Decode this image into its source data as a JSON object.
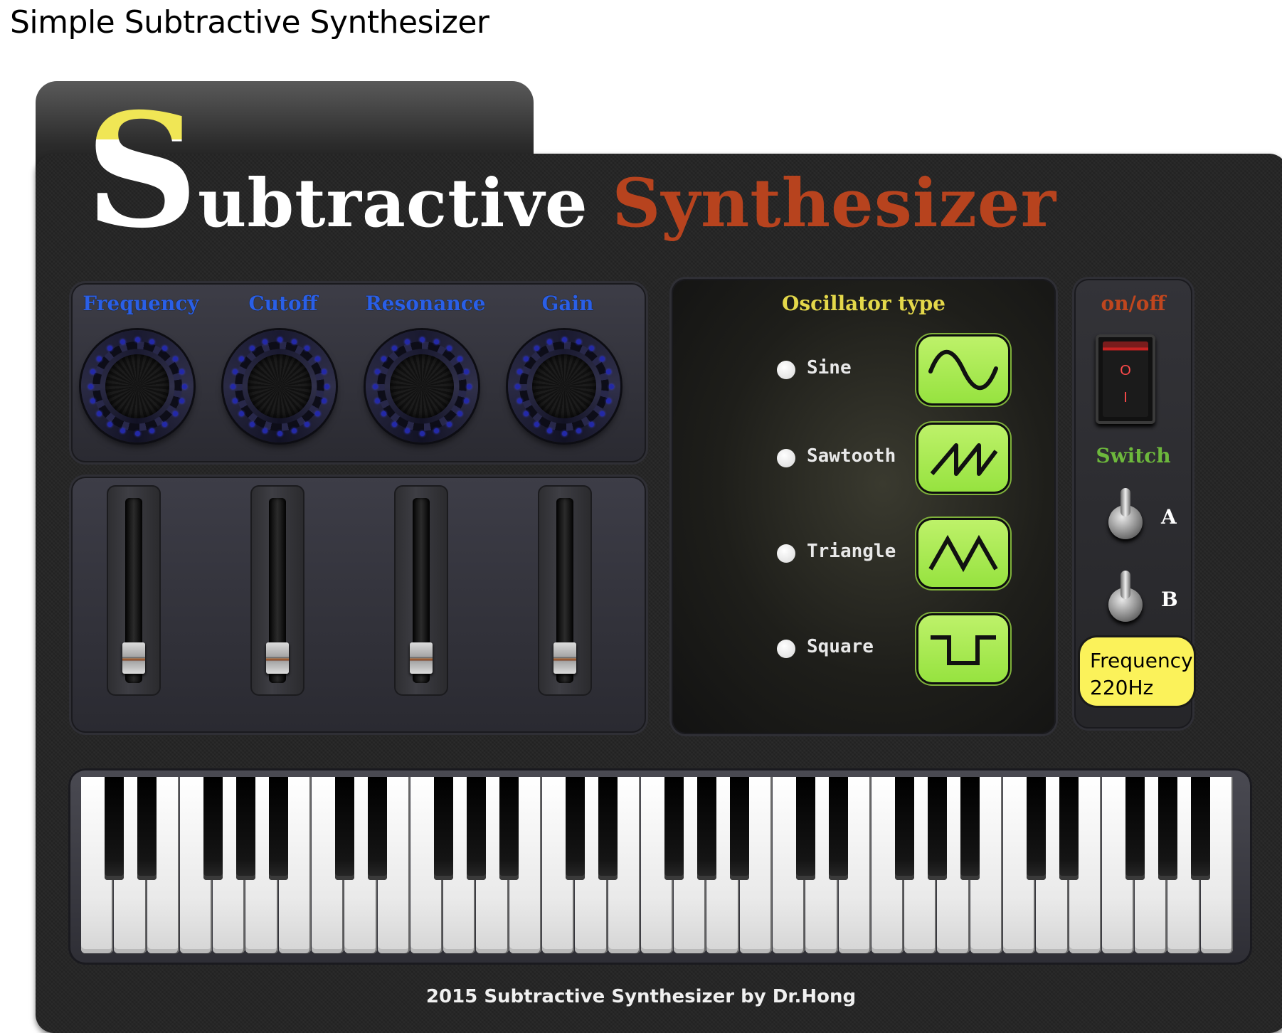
{
  "page_title": "Simple Subtractive Synthesizer",
  "logo": {
    "initial": "S",
    "rest": "ubtractive",
    "second_word": "Synthesizer"
  },
  "knobs": [
    {
      "label": "Frequency"
    },
    {
      "label": "Cutoff"
    },
    {
      "label": "Resonance"
    },
    {
      "label": "Gain"
    }
  ],
  "sliders": [
    {
      "level": 0.05
    },
    {
      "level": 0.05
    },
    {
      "level": 0.05
    },
    {
      "level": 0.05
    }
  ],
  "oscillator": {
    "title": "Oscillator type",
    "options": [
      {
        "name": "Sine",
        "wave": "sine-icon"
      },
      {
        "name": "Sawtooth",
        "wave": "sawtooth-icon"
      },
      {
        "name": "Triangle",
        "wave": "triangle-icon"
      },
      {
        "name": "Square",
        "wave": "square-icon"
      }
    ]
  },
  "power": {
    "label": "on/off",
    "rocker_top": "O",
    "rocker_bottom": "I",
    "switch_label": "Switch",
    "switch_a": "A",
    "switch_b": "B",
    "frequency_label": "Frequency",
    "frequency_value": "220Hz"
  },
  "keyboard": {
    "white_keys": 35
  },
  "credit": "2015 Subtractive Synthesizer   by  Dr.Hong",
  "colors": {
    "knob_label": "#2a5fe6",
    "oscillator_title": "#e4d84a",
    "onoff_label": "#c0461e",
    "switch_label": "#6db83c",
    "wave_button": "#a6e84f",
    "frequency_box": "#fbf25a",
    "logo_accent": "#b7431e"
  }
}
